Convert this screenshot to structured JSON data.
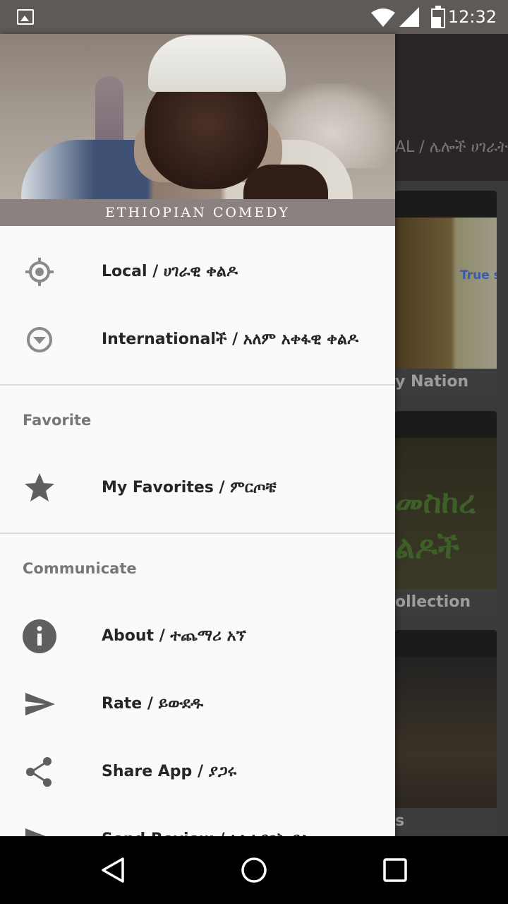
{
  "status_bar": {
    "time": "12:32",
    "icons": [
      "image-notification-icon",
      "wifi-icon",
      "signal-icon",
      "battery-icon"
    ]
  },
  "background_screen": {
    "toolbar_title_fragment": "AL / ሌሎች ሀገራት",
    "cards": [
      {
        "caption": "y Nation",
        "art_text": "True st"
      },
      {
        "caption": "ollection",
        "art_text": "መስከረ\nልዶች"
      },
      {
        "caption": "s"
      }
    ]
  },
  "drawer": {
    "header_title": "ETHIOPIAN COMEDY",
    "items": [
      {
        "label": "Local / ሀገራዊ ቀልዶ",
        "icon": "gps-target-icon"
      },
      {
        "label": "Internationalች / አለም አቀፋዊ ቀልዶ",
        "icon": "dropdown-circle-icon"
      }
    ],
    "sections": [
      {
        "title": "Favorite",
        "items": [
          {
            "label": "My Favorites / ምርጦቼ",
            "icon": "star-icon"
          }
        ]
      },
      {
        "title": "Communicate",
        "items": [
          {
            "label": "About / ተጨማሪ አኘ",
            "icon": "info-icon"
          },
          {
            "label": "Rate / ይውደዱ",
            "icon": "send-icon"
          },
          {
            "label": "Share App / ያጋሩ",
            "icon": "share-icon"
          },
          {
            "label": "Send Review / ኣስተያየት ይስጡ",
            "icon": "send-icon"
          }
        ]
      }
    ]
  },
  "nav_bar": {
    "buttons": [
      "back-icon",
      "home-icon",
      "recents-icon"
    ]
  },
  "colors": {
    "status_bar": "#5f5a58",
    "drawer_bg": "#fafafa",
    "header_band": "#8a8180",
    "icon_grey": "#666666",
    "label_text": "#262626",
    "section_title": "#777777"
  }
}
